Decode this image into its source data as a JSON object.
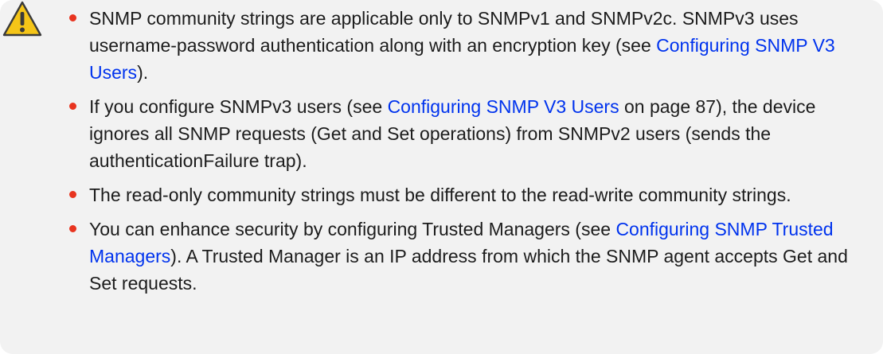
{
  "note": {
    "icon": "warning-icon",
    "colors": {
      "background": "#f2f2f2",
      "bullet": "#e8341f",
      "link": "#0033ee",
      "icon_fill": "#f5c518",
      "text": "#1c1c1c"
    },
    "items": [
      {
        "t1": "SNMP community strings are applicable only to SNMPv1 and SNMPv2c. SNMPv3 uses username-password authentication along with an encryption key (see ",
        "link": "Configuring SNMP V3 Users",
        "t2": ")."
      },
      {
        "t1": "If you configure SNMPv3 users (see ",
        "link": "Configuring SNMP V3 Users",
        "t2": " on page 87), the device ignores all SNMP requests (Get and Set operations) from SNMPv2 users (sends the authenticationFailure trap)."
      },
      {
        "t1": "The read-only community strings must be different to the read-write community strings.",
        "link": "",
        "t2": ""
      },
      {
        "t1": "You can enhance security by configuring Trusted Managers (see ",
        "link": "Configuring SNMP Trusted Managers",
        "t2": "). A Trusted Manager is an IP address from which the SNMP agent accepts Get and Set requests."
      }
    ]
  }
}
